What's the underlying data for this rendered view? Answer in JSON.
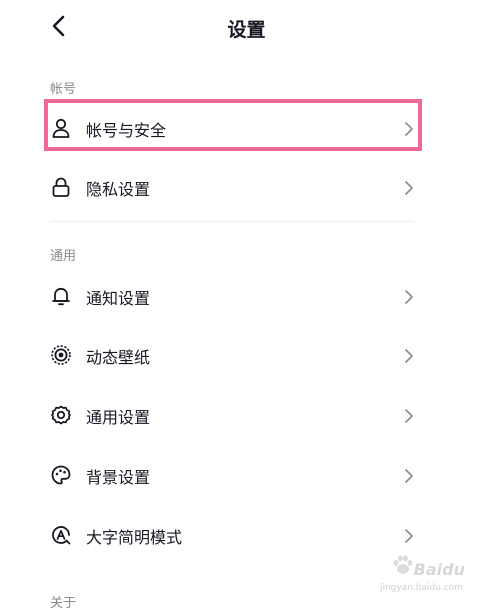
{
  "header": {
    "title": "设置"
  },
  "sections": [
    {
      "label": "帐号",
      "items": [
        {
          "label": "帐号与安全",
          "icon": "user-icon"
        },
        {
          "label": "隐私设置",
          "icon": "lock-icon"
        }
      ]
    },
    {
      "label": "通用",
      "items": [
        {
          "label": "通知设置",
          "icon": "bell-icon"
        },
        {
          "label": "动态壁纸",
          "icon": "live-wallpaper-icon"
        },
        {
          "label": "通用设置",
          "icon": "gear-icon"
        },
        {
          "label": "背景设置",
          "icon": "palette-icon"
        },
        {
          "label": "大字简明模式",
          "icon": "large-text-icon"
        }
      ]
    },
    {
      "label": "关于"
    }
  ],
  "watermark": {
    "brand": "Baidu",
    "sub": "jingyan.baidu.com"
  },
  "colors": {
    "highlight": "#f0699a",
    "text": "#161823",
    "muted": "#8a8b91"
  }
}
